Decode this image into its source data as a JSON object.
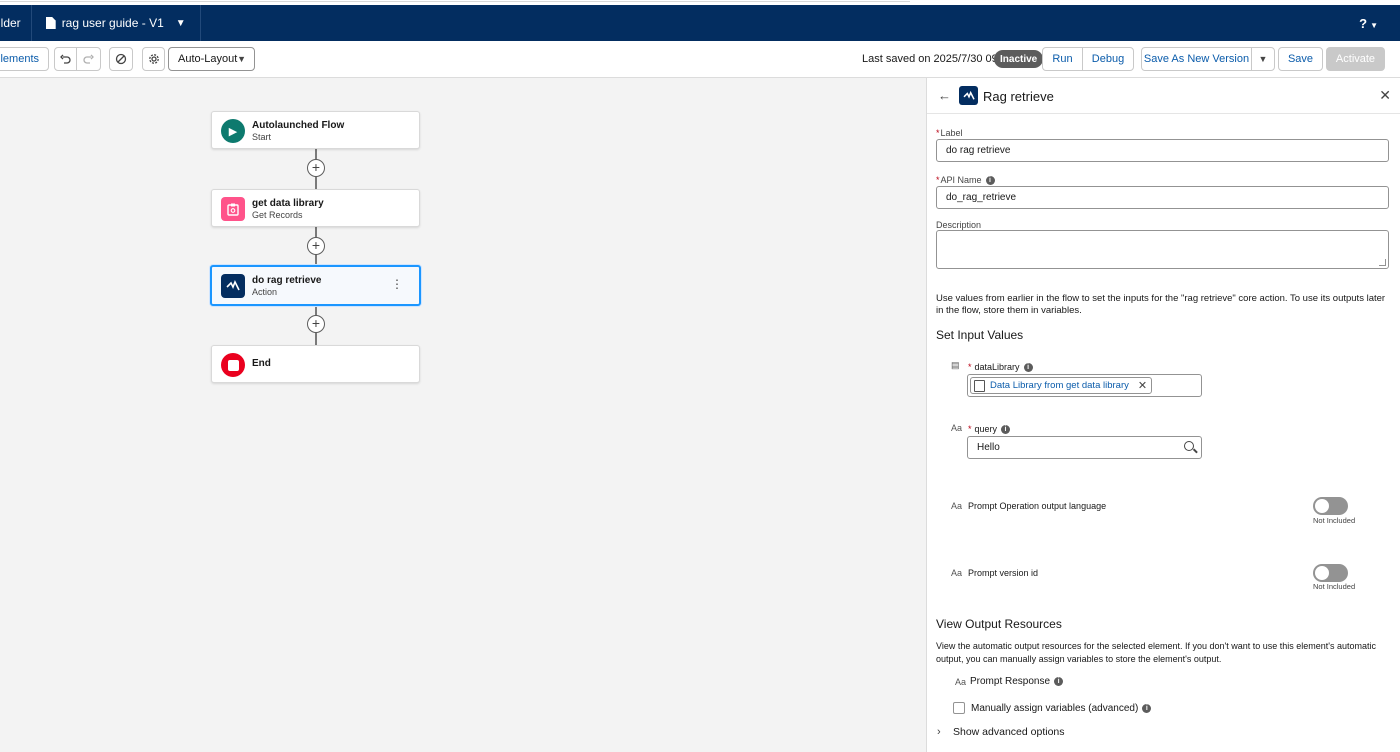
{
  "header": {
    "app_name": "ilder",
    "file_tab_label": "rag user guide - V1",
    "help_label": "?"
  },
  "toolbar": {
    "elements_label": "Elements",
    "undo_icon": "undo-icon",
    "redo_icon": "redo-icon",
    "layout_mode": "Auto-Layout",
    "last_saved": "Last saved on 2025/7/30 09:51",
    "status_badge": "Inactive",
    "run_label": "Run",
    "debug_label": "Debug",
    "save_as_new_version_label": "Save As New Version",
    "save_label": "Save",
    "activate_label": "Activate"
  },
  "canvas": {
    "nodes": [
      {
        "title": "Autolaunched Flow",
        "subtitle": "Start",
        "icon": "play-icon",
        "color": "#0d7a6e"
      },
      {
        "title": "get data library",
        "subtitle": "Get Records",
        "icon": "get-records-icon",
        "color": "#ff538a"
      },
      {
        "title": "do rag retrieve",
        "subtitle": "Action",
        "icon": "action-icon",
        "color": "#032d60"
      },
      {
        "title": "End",
        "subtitle": "",
        "icon": "stop-icon",
        "color": "#ea001e"
      }
    ]
  },
  "panel": {
    "title": "Rag retrieve",
    "label_field": {
      "label": "Label",
      "value": "do rag retrieve"
    },
    "api_name_field": {
      "label": "API Name",
      "value": "do_rag_retrieve"
    },
    "description_field": {
      "label": "Description",
      "value": ""
    },
    "help_text": "Use values from earlier in the flow to set the inputs for the \"rag retrieve\" core action. To use its outputs later in the flow, store them in variables.",
    "set_input_values_heading": "Set Input Values",
    "inputs": {
      "data_library": {
        "label": "dataLibrary",
        "value": "Data Library from get data library"
      },
      "query": {
        "label": "query",
        "value": "Hello"
      },
      "output_language": {
        "label": "Prompt Operation output language",
        "toggle_state": "Not Included"
      },
      "prompt_version": {
        "label": "Prompt version id",
        "toggle_state": "Not Included"
      }
    },
    "view_output_heading": "View Output Resources",
    "output_help": "View the automatic output resources for the selected element. If you don't want to use this element's automatic output, you can manually assign variables to store the element's output.",
    "prompt_response_label": "Prompt Response",
    "manual_assign_label": "Manually assign variables (advanced)",
    "advanced_options_label": "Show advanced options",
    "text_type_marker": "Aa"
  }
}
